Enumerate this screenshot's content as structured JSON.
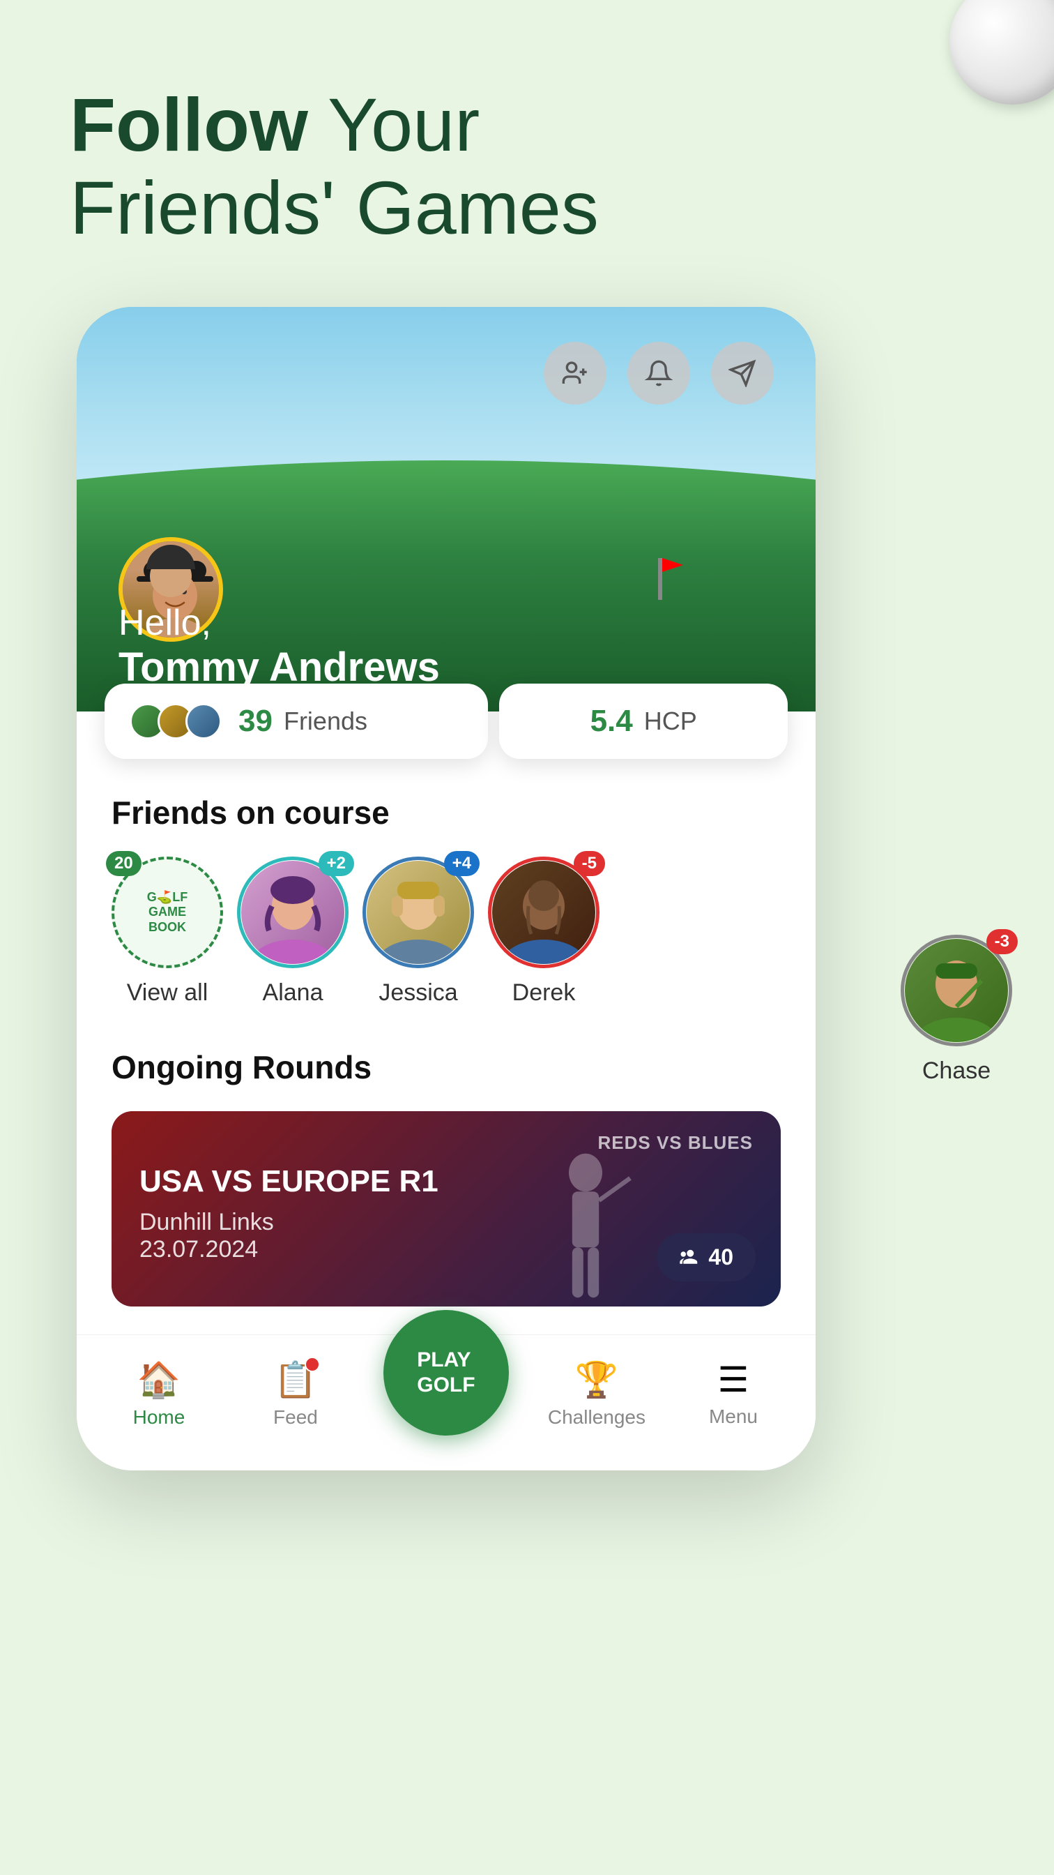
{
  "page": {
    "background_color": "#e8f5e3"
  },
  "header": {
    "title_bold": "Follow",
    "title_normal": " Your\nFriends' Games"
  },
  "hero": {
    "greeting": "Hello,",
    "user_name": "Tommy Andrews",
    "add_friend_icon": "add-friend-icon",
    "bell_icon": "bell-icon",
    "send_icon": "send-icon"
  },
  "stats": {
    "friends_count": "39",
    "friends_label": "Friends",
    "hcp_value": "5.4",
    "hcp_label": "HCP"
  },
  "friends_section": {
    "title": "Friends on course",
    "friends": [
      {
        "name": "View all",
        "score": "20",
        "badge_color": "green",
        "type": "view_all"
      },
      {
        "name": "Alana",
        "score": "+2",
        "badge_color": "teal",
        "ring_color": "teal"
      },
      {
        "name": "Jessica",
        "score": "+4",
        "badge_color": "blue",
        "ring_color": "blue"
      },
      {
        "name": "Derek",
        "score": "-5",
        "badge_color": "red",
        "ring_color": "red"
      }
    ],
    "outside_friend": {
      "name": "Chase",
      "score": "-3",
      "badge_color": "red",
      "ring_color": "gray"
    }
  },
  "ongoing_rounds": {
    "title": "Ongoing Rounds",
    "card": {
      "subtitle": "REDS VS BLUES",
      "main_title": "USA VS EUROPE R1",
      "course": "Dunhill Links",
      "date": "23.07.2024",
      "players_count": "40"
    }
  },
  "bottom_nav": {
    "items": [
      {
        "id": "home",
        "label": "Home",
        "icon": "🏠",
        "active": true
      },
      {
        "id": "feed",
        "label": "Feed",
        "icon": "📋",
        "active": false,
        "has_notification": true
      },
      {
        "id": "play_golf",
        "label": "PLAY\nGOLF",
        "icon": "",
        "active": false,
        "is_cta": true
      },
      {
        "id": "challenges",
        "label": "Challenges",
        "icon": "🏆",
        "active": false
      },
      {
        "id": "menu",
        "label": "Menu",
        "icon": "☰",
        "active": false
      }
    ]
  },
  "gamebook_logo": {
    "line1": "G⛳LF",
    "line2": "GAME",
    "line3": "BOOK"
  }
}
